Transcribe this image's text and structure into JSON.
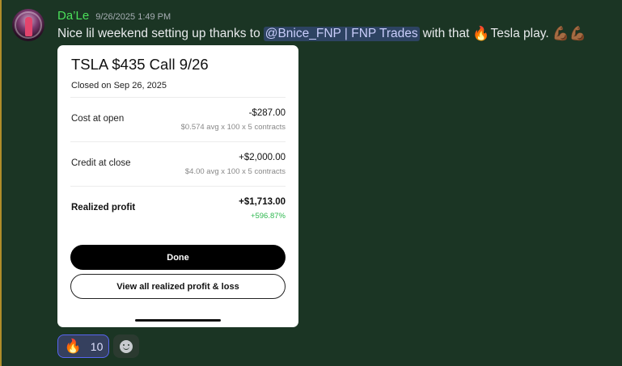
{
  "message": {
    "author": "Da’Le",
    "timestamp": "9/26/2025 1:49 PM",
    "text_before": "Nice lil weekend setting up thanks to",
    "mention": "@Bnice_FNP | FNP Trades",
    "text_middle": "with that",
    "emoji_fire": "🔥",
    "text_after": "Tesla play.",
    "emoji_muscles": "💪🏾💪🏾"
  },
  "card": {
    "title": "TSLA $435 Call 9/26",
    "subtitle": "Closed on Sep 26, 2025",
    "rows": [
      {
        "label": "Cost at open",
        "value": "-$287.00",
        "detail": "$0.574 avg x 100 x 5 contracts"
      },
      {
        "label": "Credit at close",
        "value": "+$2,000.00",
        "detail": "$4.00 avg x 100 x 5 contracts"
      },
      {
        "label": "Realized profit",
        "value": "+$1,713.00",
        "detail": "+596.87%"
      }
    ],
    "done_label": "Done",
    "view_label": "View all realized profit & loss"
  },
  "reactions": [
    {
      "emoji": "🔥",
      "count": "10"
    }
  ],
  "colors": {
    "background": "#1b3524",
    "username": "#4be05a",
    "mention_bg": "#3c4a8a",
    "profit_green": "#2eb84f"
  }
}
